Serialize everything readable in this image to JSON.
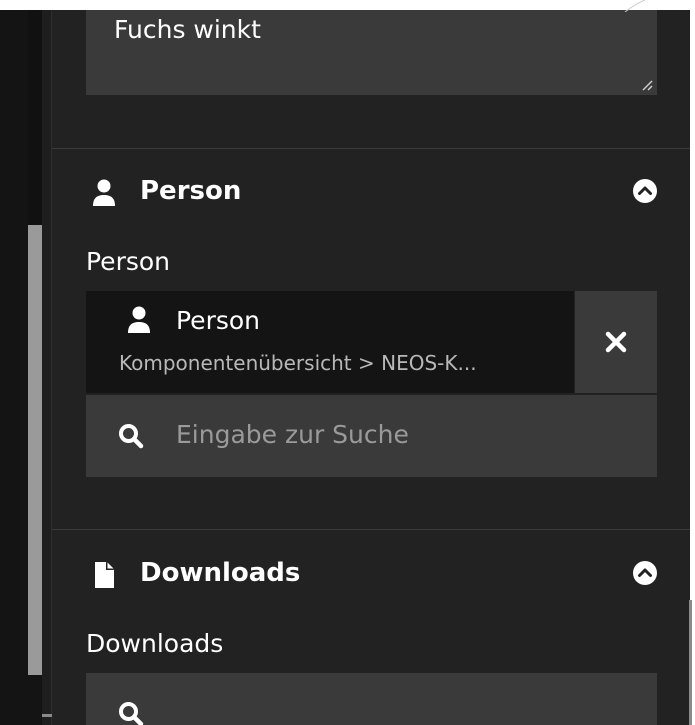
{
  "textarea": {
    "value": "Fuchs winkt"
  },
  "person_section": {
    "title": "Person",
    "field_label": "Person",
    "reference": {
      "title": "Person",
      "path": "Komponentenübersicht > NEOS-K..."
    },
    "search_placeholder": "Eingabe zur Suche"
  },
  "downloads_section": {
    "title": "Downloads",
    "field_label": "Downloads",
    "search_placeholder": ""
  },
  "colors": {
    "panel": "#222222",
    "input": "#3a3a3a",
    "selected": "#141414"
  }
}
